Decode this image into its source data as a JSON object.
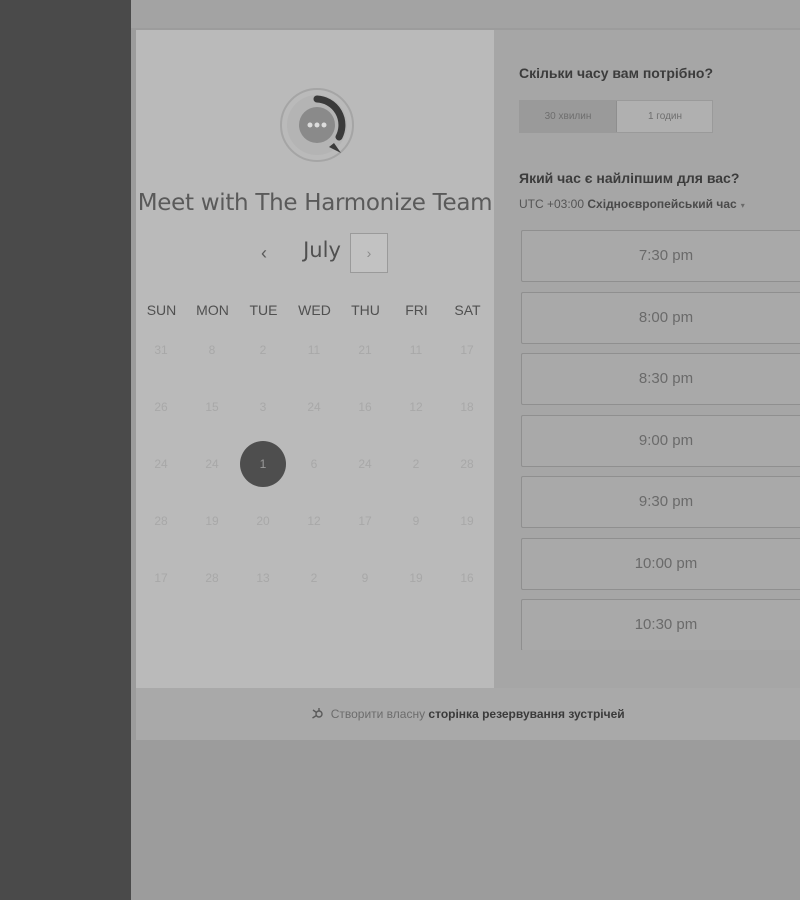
{
  "scheduler": {
    "org_title": "Meet with The Harmonize Team",
    "avatar_icon": "chat-ellipsis-icon",
    "month": "July",
    "prev_icon": "‹",
    "next_icon": "›",
    "weekdays": [
      "SUN",
      "MON",
      "TUE",
      "WED",
      "THU",
      "FRI",
      "SAT"
    ],
    "weeks": [
      [
        "31",
        "8",
        "2",
        "11",
        "21",
        "11",
        "17"
      ],
      [
        "26",
        "15",
        "3",
        "24",
        "16",
        "12",
        "18"
      ],
      [
        "24",
        "24",
        "1",
        "6",
        "24",
        "2",
        "28"
      ],
      [
        "28",
        "19",
        "20",
        "12",
        "17",
        "9",
        "19"
      ],
      [
        "17",
        "28",
        "13",
        "2",
        "9",
        "19",
        "16"
      ]
    ],
    "selected_day": "1"
  },
  "duration": {
    "question": "Скільки часу вам потрібно?",
    "options": [
      "30 хвилин",
      "1 годин"
    ],
    "selected": "30 хвилин"
  },
  "time": {
    "question": "Який час є найліпшим для вас?",
    "utc": "UTC +03:00",
    "tz_name": "Східноєвропейський час",
    "caret": "▾",
    "slots": [
      "7:30 pm",
      "8:00 pm",
      "8:30 pm",
      "9:00 pm",
      "9:30 pm",
      "10:00 pm",
      "10:30 pm"
    ]
  },
  "footer": {
    "icon": "hubspot-sprocket-icon",
    "prefix": "Створити власну",
    "link": "сторінка резервування зустрічей"
  },
  "colors": {
    "selected_day_bg": "#4e4e4e",
    "accent": "#3c3c3c"
  }
}
